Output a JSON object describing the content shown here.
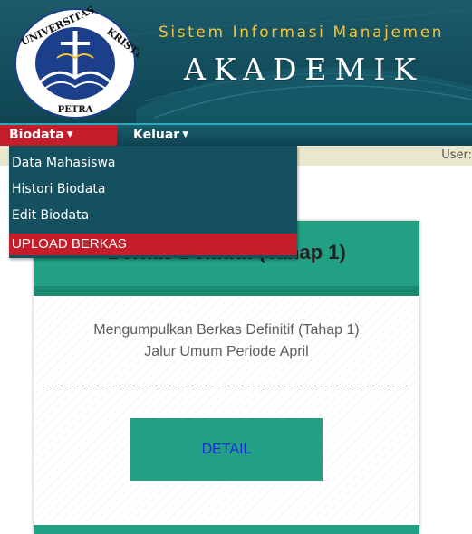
{
  "header": {
    "subtitle": "Sistem Informasi Manajemen",
    "title": "AKADEMIK",
    "logo": {
      "top_text": "UNIVERSITAS KRISTEN",
      "bottom_text": "PETRA"
    }
  },
  "nav": {
    "items": [
      {
        "label": "Biodata",
        "active": true
      },
      {
        "label": "Keluar",
        "active": false
      }
    ],
    "dropdown": [
      "Data Mahasiswa",
      "Histori Biodata",
      "Edit Biodata",
      "UPLOAD BERKAS"
    ]
  },
  "user_strip": {
    "label": "User:"
  },
  "card": {
    "heading": "Berkas Definitif (Tahap 1)",
    "description_line1": "Mengumpulkan Berkas Definitif (Tahap 1)",
    "description_line2": "Jalur Umum Periode April",
    "button_label": "DETAIL"
  },
  "colors": {
    "header_bg": "#14505f",
    "accent_red": "#c41e2a",
    "card_green": "#21a083",
    "subtitle_gold": "#f2c433",
    "button_text_blue": "#1a2bd8"
  }
}
